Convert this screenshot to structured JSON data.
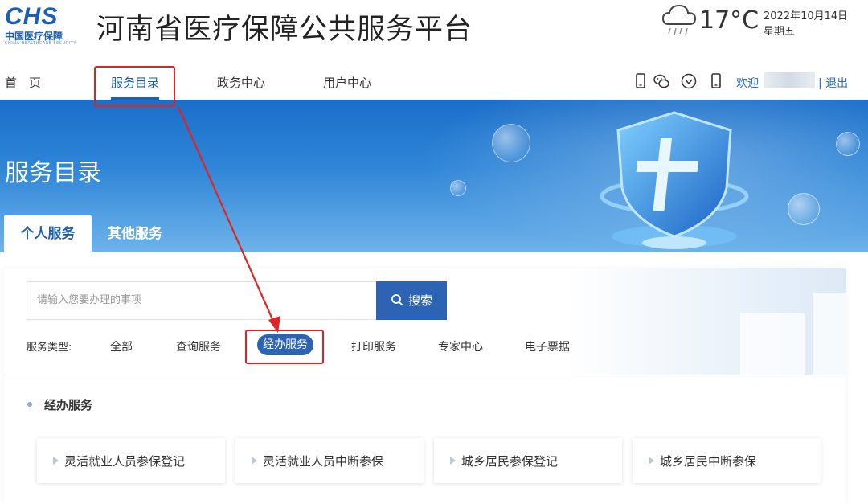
{
  "header": {
    "logo_mark": "CHS",
    "logo_cn": "中国医疗保障",
    "logo_en": "CHINA HEALTHCARE SECURITY",
    "site_title": "河南省医疗保障公共服务平台",
    "weather": {
      "icon": "rain-cloud-icon",
      "temperature": "17°C"
    },
    "date": "2022年10月14日",
    "weekday": "星期五"
  },
  "nav": {
    "items": [
      {
        "label": "首　页"
      },
      {
        "label": "服务目录",
        "active": true
      },
      {
        "label": "政务中心"
      },
      {
        "label": "用户中心"
      }
    ],
    "icons": [
      "mobile-icon",
      "wechat-icon",
      "accessibility-icon",
      "phone-icon"
    ],
    "welcome": "欢迎",
    "logout": "| 退出"
  },
  "banner": {
    "title": "服务目录",
    "tabs": [
      {
        "label": "个人服务",
        "active": true
      },
      {
        "label": "其他服务"
      }
    ]
  },
  "search": {
    "placeholder": "请输入您要办理的事项",
    "button_label": "搜索"
  },
  "filters": {
    "label": "服务类型:",
    "items": [
      "全部",
      "查询服务",
      "经办服务",
      "打印服务",
      "专家中心",
      "电子票据"
    ],
    "selected": "经办服务"
  },
  "section": {
    "title": "经办服务",
    "items": [
      "灵活就业人员参保登记",
      "灵活就业人员中断参保",
      "城乡居民参保登记",
      "城乡居民中断参保"
    ]
  },
  "colors": {
    "primary": "#1e5fb5",
    "button": "#2c64b3",
    "annotation": "#e02424",
    "link": "#2a6dc9"
  }
}
